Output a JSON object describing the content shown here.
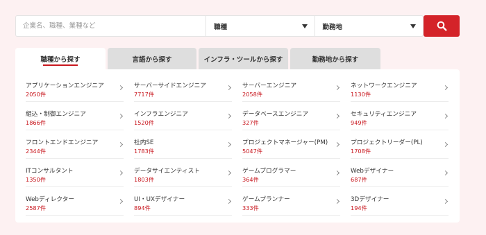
{
  "search": {
    "placeholder": "企業名、職種、業種など",
    "job_select": "職種",
    "location_select": "勤務地",
    "button_icon": "search-icon"
  },
  "tabs": [
    {
      "label": "職種から探す",
      "active": true
    },
    {
      "label": "言語から探す",
      "active": false
    },
    {
      "label": "インフラ・ツールから探す",
      "active": false
    },
    {
      "label": "勤務地から探す",
      "active": false
    }
  ],
  "colors": {
    "accent": "#c8161d",
    "search_button": "#d42329",
    "background": "#fdf1f2"
  },
  "jobs": [
    [
      {
        "name": "アプリケーションエンジニア",
        "count": "2050件"
      },
      {
        "name": "サーバーサイドエンジニア",
        "count": "7717件"
      },
      {
        "name": "サーバーエンジニア",
        "count": "2058件"
      },
      {
        "name": "ネットワークエンジニア",
        "count": "1130件"
      }
    ],
    [
      {
        "name": "組込・制御エンジニア",
        "count": "1866件"
      },
      {
        "name": "インフラエンジニア",
        "count": "1520件"
      },
      {
        "name": "データベースエンジニア",
        "count": "327件"
      },
      {
        "name": "セキュリティエンジニア",
        "count": "949件"
      }
    ],
    [
      {
        "name": "フロントエンドエンジニア",
        "count": "2344件"
      },
      {
        "name": "社内SE",
        "count": "1783件"
      },
      {
        "name": "プロジェクトマネージャー(PM)",
        "count": "5047件"
      },
      {
        "name": "プロジェクトリーダー(PL)",
        "count": "1708件"
      }
    ],
    [
      {
        "name": "ITコンサルタント",
        "count": "1350件"
      },
      {
        "name": "データサイエンティスト",
        "count": "1803件"
      },
      {
        "name": "ゲームプログラマー",
        "count": "364件"
      },
      {
        "name": "Webデザイナー",
        "count": "687件"
      }
    ],
    [
      {
        "name": "Webディレクター",
        "count": "2587件"
      },
      {
        "name": "UI・UXデザイナー",
        "count": "894件"
      },
      {
        "name": "ゲームプランナー",
        "count": "333件"
      },
      {
        "name": "3Dデザイナー",
        "count": "194件"
      }
    ]
  ]
}
